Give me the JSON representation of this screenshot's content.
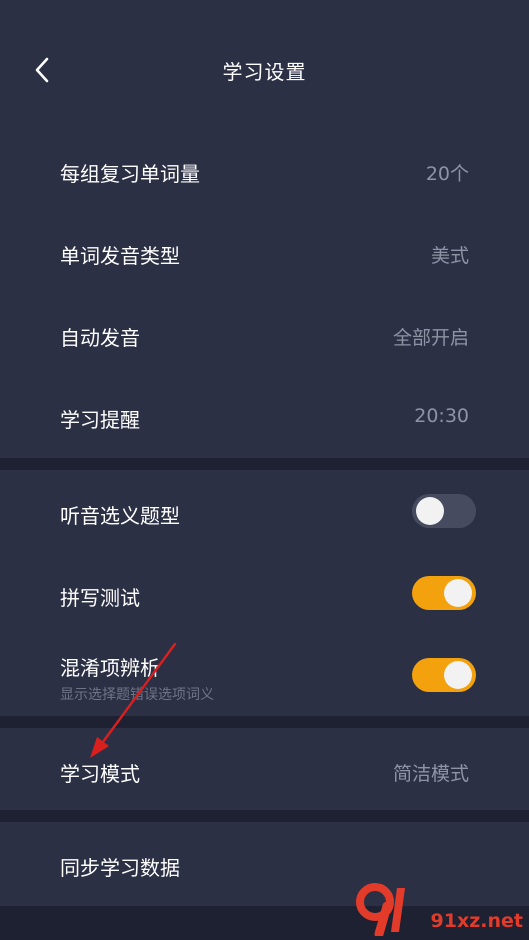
{
  "header": {
    "title": "学习设置",
    "back_icon": "chevron-left-icon"
  },
  "settings_group_1": [
    {
      "label": "每组复习单词量",
      "value": "20个"
    },
    {
      "label": "单词发音类型",
      "value": "美式"
    },
    {
      "label": "自动发音",
      "value": "全部开启"
    },
    {
      "label": "学习提醒",
      "value": "20:30"
    }
  ],
  "settings_group_2": [
    {
      "label": "听音选义题型",
      "toggle": false
    },
    {
      "label": "拼写测试",
      "toggle": true
    },
    {
      "label": "混淆项辨析",
      "subtitle": "显示选择题错误选项词义",
      "toggle": true
    }
  ],
  "study_mode": {
    "label": "学习模式",
    "value": "简洁模式"
  },
  "sync": {
    "label": "同步学习数据"
  },
  "watermark": {
    "text": "91xz.net"
  },
  "colors": {
    "background": "#2a2e42",
    "section": "#2c3045",
    "separator": "#1e2131",
    "toggle_on": "#f3a10c",
    "toggle_off": "#474b5f",
    "value_text": "#8e93a6",
    "annotation_arrow": "#d9201e"
  }
}
